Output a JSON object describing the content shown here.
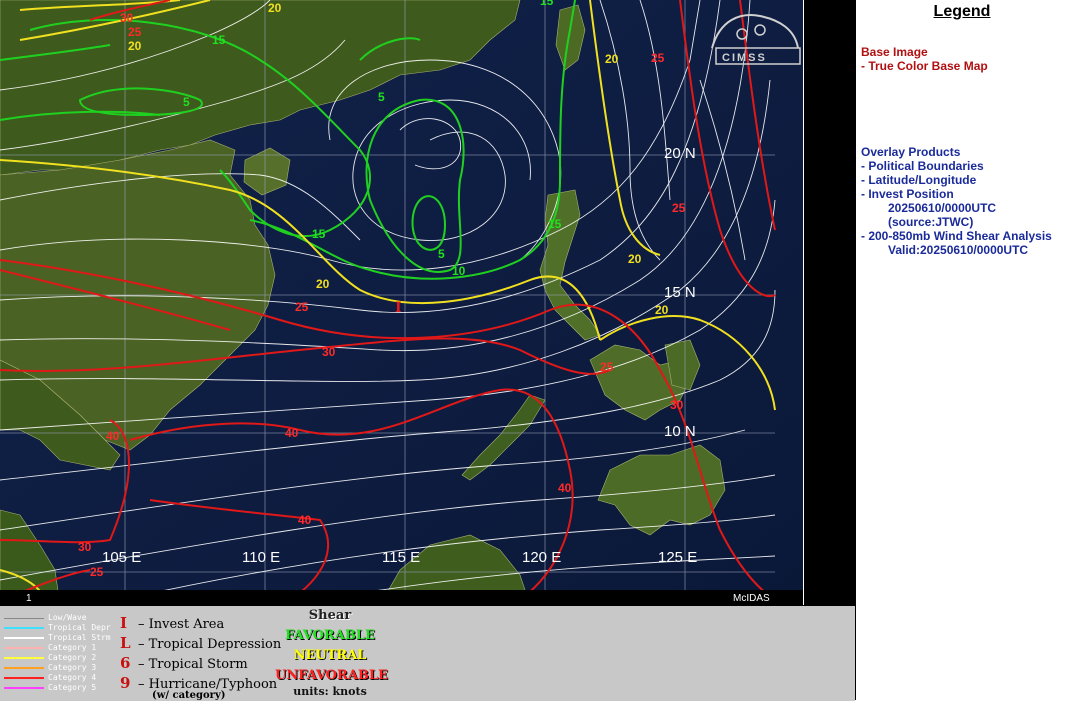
{
  "map": {
    "latitude_labels": [
      "20 N",
      "15 N",
      "10 N"
    ],
    "longitude_labels": [
      "105 E",
      "110 E",
      "115 E",
      "120 E",
      "125 E"
    ],
    "frame_number": "1",
    "software_label": "McIDAS",
    "logo_text": "CIMSS",
    "invest_marker": "I",
    "contour_values": {
      "green": [
        "15",
        "5",
        "5",
        "15",
        "15",
        "10",
        "5",
        "15"
      ],
      "yellow": [
        "20",
        "20",
        "20",
        "20",
        "20",
        "20"
      ],
      "red": [
        "30",
        "25",
        "25",
        "25",
        "30",
        "25",
        "25",
        "30",
        "40",
        "40",
        "40",
        "40",
        "30",
        "25"
      ]
    }
  },
  "legend": {
    "title": "Legend",
    "base_image_header": "Base Image",
    "base_image_item": "-  True Color Base Map",
    "overlay_header": "Overlay Products",
    "overlay_items": [
      "-  Political Boundaries",
      "-  Latitude/Longitude",
      "-  Invest Position",
      "20250610/0000UTC",
      "(source:JTWC)",
      "-  200-850mb Wind Shear Analysis",
      "Valid:20250610/0000UTC"
    ]
  },
  "storm_key": {
    "rows": [
      {
        "label": "Low/Wave",
        "color": "#c8c8c8"
      },
      {
        "label": "Tropical Depr",
        "color": "#40e0ff"
      },
      {
        "label": "Tropical Strm",
        "color": "#ffffff"
      },
      {
        "label": "Category 1",
        "color": "#ffb0b0"
      },
      {
        "label": "Category 2",
        "color": "#ffff40"
      },
      {
        "label": "Category 3",
        "color": "#ffa020"
      },
      {
        "label": "Category 4",
        "color": "#ff2020"
      },
      {
        "label": "Category 5",
        "color": "#ff40ff"
      }
    ],
    "symbols": [
      {
        "sym": "I",
        "label": "– Invest Area"
      },
      {
        "sym": "L",
        "label": "– Tropical Depression"
      },
      {
        "sym": "6",
        "label": "– Tropical Storm"
      },
      {
        "sym": "9",
        "label": "– Hurricane/Typhoon"
      }
    ],
    "category_note": "(w/ category)",
    "shear_title": "Shear",
    "shear_levels": [
      {
        "label": "FAVORABLE",
        "color": "#20e020"
      },
      {
        "label": "NEUTRAL",
        "color": "#ffff00"
      },
      {
        "label": "UNFAVORABLE",
        "color": "#ff2020"
      }
    ],
    "units": "units: knots"
  }
}
